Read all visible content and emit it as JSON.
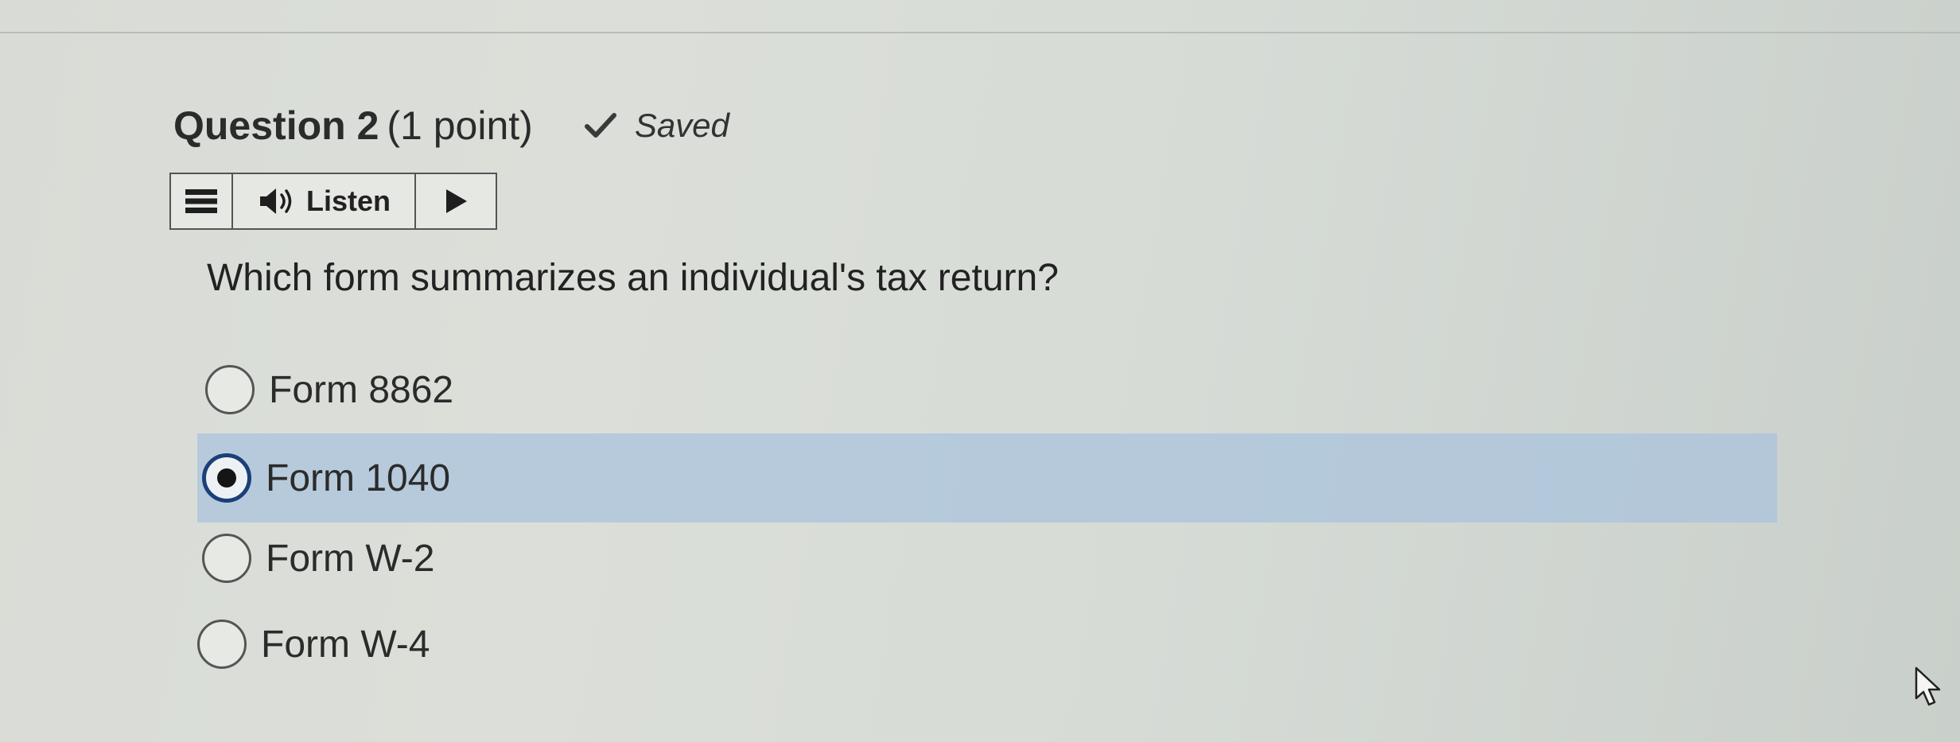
{
  "question": {
    "number_label": "Question 2",
    "points_label": "(1 point)",
    "status": "Saved",
    "prompt": "Which form summarizes an individual's tax return?"
  },
  "listen_toolbar": {
    "listen_label": "Listen",
    "icons": [
      "menu-icon",
      "speaker-icon",
      "play-icon"
    ]
  },
  "options": [
    {
      "label": "Form 8862",
      "selected": false
    },
    {
      "label": "Form 1040",
      "selected": true
    },
    {
      "label": "Form W-2",
      "selected": false
    },
    {
      "label": "Form W-4",
      "selected": false
    }
  ],
  "colors": {
    "selected_highlight": "#aac3dc",
    "radio_selected_border": "#1b3f78"
  }
}
